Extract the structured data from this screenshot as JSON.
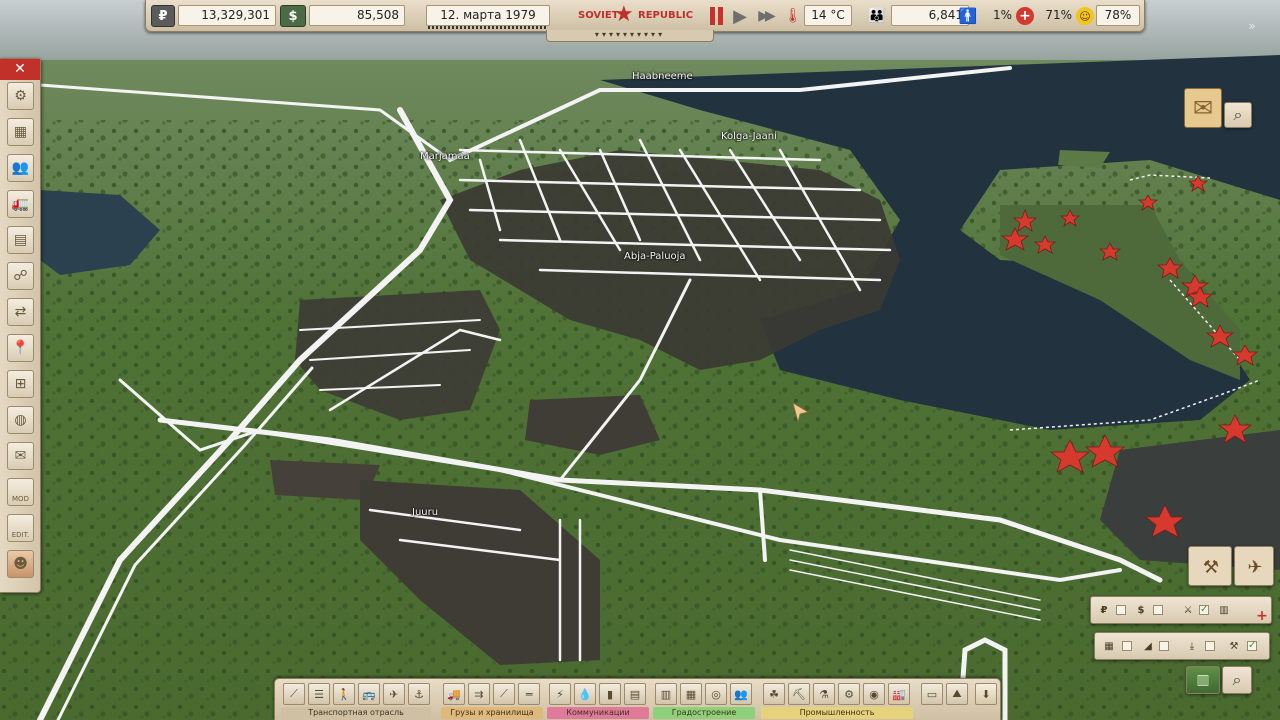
{
  "topbar": {
    "rubles": "13,329,301",
    "dollars": "85,508",
    "date": "12. марта 1979",
    "logo_left": "SOVIET",
    "logo_right": "REPUBLIC",
    "temperature": "14 °C",
    "population": "6,841",
    "unemployment": "1%",
    "health": "71%",
    "happiness": "78%",
    "ruble_symbol": "₽",
    "dollar_symbol": "$"
  },
  "map_labels": {
    "haabneeme": "Haabneeme",
    "kolga_jaani": "Kolga-Jaani",
    "marjamaa": "Marjamaa",
    "abja_paluoja": "Abja-Paluoja",
    "juuru": "Juuru"
  },
  "bottombar": {
    "categories": [
      "Транспортная отрасль",
      "Грузы и хранилища",
      "Коммуникации",
      "Градостроение",
      "Промышленность"
    ],
    "category_colors": [
      "#cfc0a4",
      "#e0b97a",
      "#e07a9a",
      "#8fd07a",
      "#e6d27a"
    ]
  },
  "colors": {
    "water": "#1f2f3e",
    "grass": "#4d6d34",
    "city": "#3a3933",
    "roads": "#f2f2f2",
    "star": "#d83a30",
    "close_red": "#c2302a"
  },
  "icons": {
    "sidebar": [
      "gear-icon",
      "warehouse-icon",
      "people-icon",
      "vehicles-icon",
      "documents-icon",
      "network-icon",
      "trade-icon",
      "location-pin-icon",
      "district-add-icon",
      "globe-icon",
      "mail-icon",
      "mod-icon",
      "edit-icon",
      "portrait-icon"
    ]
  },
  "sidebar_text": {
    "mod": "MOD",
    "edit": "EDIT."
  }
}
